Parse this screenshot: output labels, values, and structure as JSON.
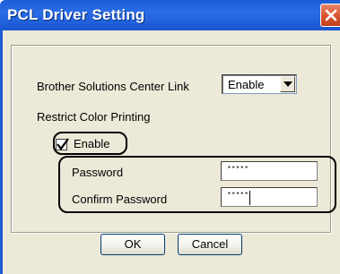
{
  "window": {
    "title": "PCL Driver Setting"
  },
  "settings": {
    "solutions_center_label": "Brother Solutions Center Link",
    "solutions_center_value": "Enable",
    "restrict_color_label": "Restrict Color Printing",
    "enable_label": "Enable",
    "enable_checked": true,
    "password_label": "Password",
    "password_value": "*****",
    "confirm_password_label": "Confirm Password",
    "confirm_password_value": "*****"
  },
  "buttons": {
    "ok": "OK",
    "cancel": "Cancel"
  },
  "icons": {
    "close": "close-icon",
    "dropdown": "chevron-down-icon",
    "check": "check-icon"
  },
  "colors": {
    "titlebar": "#2a6de6",
    "close_button": "#d9532f",
    "dialog_background": "#ece9d8"
  }
}
